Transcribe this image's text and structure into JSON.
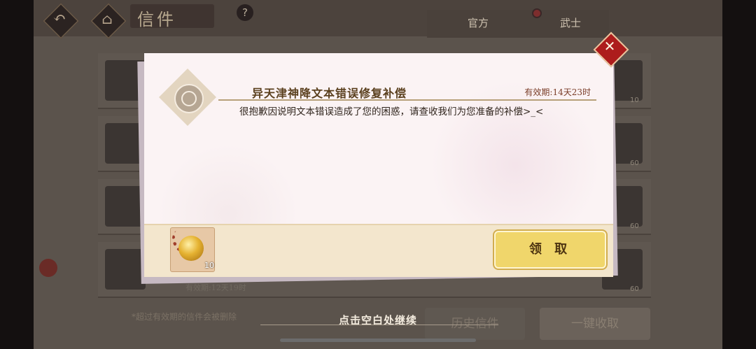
{
  "background": {
    "title": "信件",
    "help_icon": "?",
    "tabs": [
      "官方",
      "武士"
    ],
    "row_counts": [
      "10",
      "60",
      "60",
      "60"
    ],
    "expiry_text": "有效期:12天19时",
    "note": "*超过有效期的信件会被删除",
    "history_button": "历史信件",
    "one_key_button": "一键收取"
  },
  "mail": {
    "title": "异天津神降文本错误修复补偿",
    "expiry": "有效期:14天23时",
    "body": "很抱歉因说明文本错误造成了您的困惑，请查收我们为您准备的补偿>_<",
    "reward": {
      "icon": "golden-bell-icon",
      "count": "10"
    },
    "claim_button": "领 取"
  },
  "continue_hint": "点击空白处继续",
  "colors": {
    "dialog_bg": "#fbf3f4",
    "claim_button": "#f0d66b",
    "close_button": "#ad1c1c",
    "title_text": "#5a3f1d"
  }
}
